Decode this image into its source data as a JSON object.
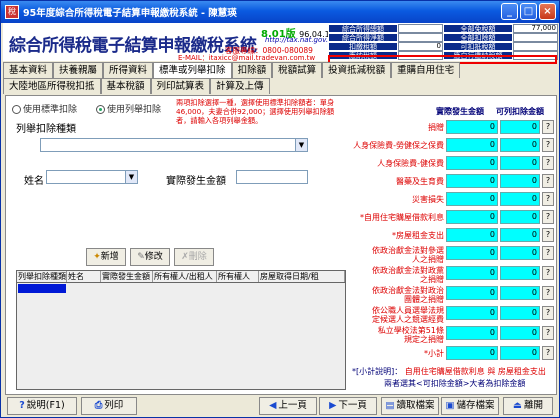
{
  "window": {
    "title": "95年度綜合所得稅電子結算申報繳稅系統 - 陳慧瑛",
    "icon": "tax-app-icon",
    "controls": [
      "_",
      "□",
      "×"
    ]
  },
  "header": {
    "logo": "綜合所得稅電子結算申報繳稅系統",
    "version": "8.01版",
    "version_date": "96.04.16製",
    "url": "http://tax.nat.gov.tw",
    "service": "客服專線：0800-080089",
    "email": "E-MAIL：itaxicc@mail.tradevan.com.tw"
  },
  "tax_summary": [
    {
      "label": "綜合所得總額",
      "value": "",
      "label2": "全部免稅額",
      "value2": "77,000"
    },
    {
      "label": "綜合所得淨額",
      "value": "",
      "label2": "全部扣除額",
      "value2": ""
    },
    {
      "label": "扣繳稅額",
      "value": "0",
      "label2": "可扣抵稅額",
      "value2": ""
    },
    {
      "label": "應納稅額",
      "value": "",
      "label2": "應自行繳納稅額",
      "value2": ""
    }
  ],
  "tabs": {
    "row1": [
      "基本資料",
      "扶養親屬",
      "所得資料",
      "標準或列舉扣除",
      "扣除額",
      "稅額試算",
      "投資抵減稅額",
      "重購自用住宅"
    ],
    "row2": [
      "大陸地區所得稅扣抵",
      "基本稅額",
      "列印試算表",
      "計算及上傳"
    ],
    "active": "標準或列舉扣除"
  },
  "deduction": {
    "radio_standard": "使用標準扣除",
    "radio_itemized": "使用列舉扣除",
    "selected": "使用列舉扣除",
    "note": "兩項扣除選擇一種，選擇使用標準扣除額者：單身46,000，夫妻合併92,000；選擇使用列舉扣除額者，請輸入各項列舉金額。",
    "type_label": "列舉扣除種類",
    "type_value": "",
    "name_label": "姓名",
    "name_value": "",
    "amount_label": "實際發生金額",
    "amount_value": "",
    "add_label": "新增",
    "edit_label": "修改",
    "delete_label": "刪除"
  },
  "grid": {
    "columns": [
      "列舉扣除種類",
      "姓名",
      "實際發生金額",
      "所有權人/出租人",
      "所有權人",
      "房屋取得日期/租"
    ]
  },
  "right_panel": {
    "col1": "實際發生金額",
    "col2": "可列扣除金額",
    "rows": [
      {
        "label": "捐贈",
        "v1": "0",
        "v2": "0"
      },
      {
        "label": "人身保險費-勞健保之保費",
        "v1": "0",
        "v2": "0"
      },
      {
        "label": "人身保險費-健保費",
        "v1": "0",
        "v2": "0"
      },
      {
        "label": "醫藥及生育費",
        "v1": "0",
        "v2": "0"
      },
      {
        "label": "災害損失",
        "v1": "0",
        "v2": "0"
      },
      {
        "label": "*自用住宅購屋借款利息",
        "v1": "0",
        "v2": "0"
      },
      {
        "label": "*房屋租金支出",
        "v1": "0",
        "v2": "0"
      },
      {
        "label": "依政治獻金法對參選人之捐贈",
        "v1": "0",
        "v2": "0"
      },
      {
        "label": "依政治獻金法對政黨之捐贈",
        "v1": "0",
        "v2": "0"
      },
      {
        "label": "依政治獻金法對政治團體之捐贈",
        "v1": "0",
        "v2": "0"
      },
      {
        "label": "依公職人員選舉法規定候選人之競選經費",
        "v1": "0",
        "v2": "0"
      },
      {
        "label": "私立學校法第51條規定之捐贈",
        "v1": "0",
        "v2": "0"
      },
      {
        "label": "*小計",
        "v1": "0",
        "v2": "0"
      }
    ],
    "note_title": "*[小計說明]：",
    "note_text": "自用住宅購屋借款利息 與 房屋租金支出",
    "note_text2": "兩者選其<可扣除金額>大者為扣除金額"
  },
  "bottom": {
    "help": "說明(F1)",
    "print": "列印",
    "prev": "上一頁",
    "next": "下一頁",
    "load": "讀取檔案",
    "save": "儲存檔案",
    "exit": "離開"
  }
}
